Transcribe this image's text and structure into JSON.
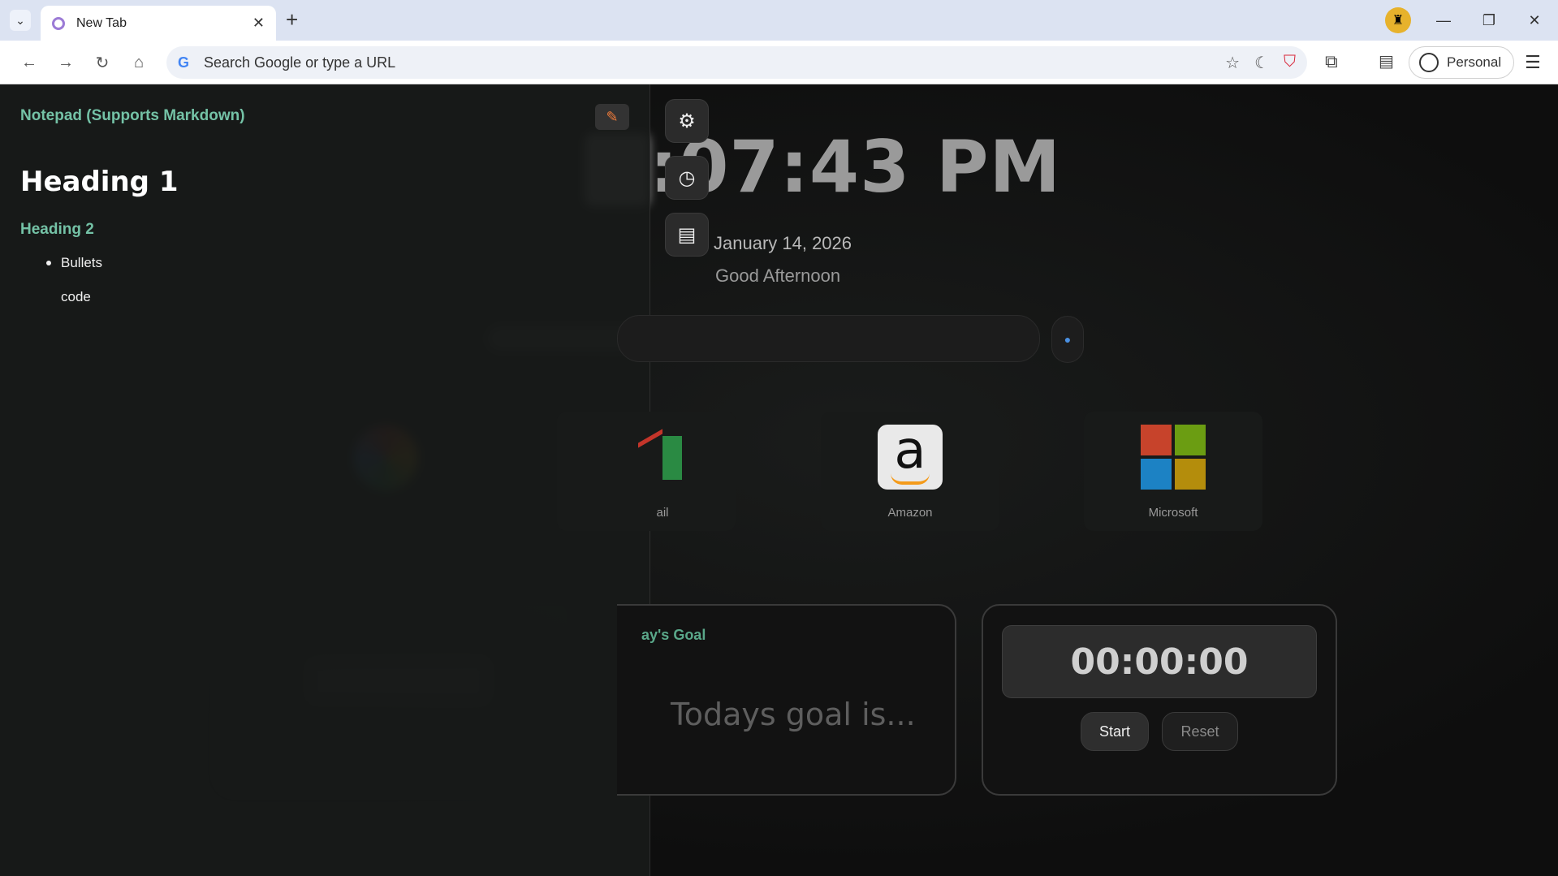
{
  "browser": {
    "tab_title": "New Tab",
    "omnibox_placeholder": "Search Google or type a URL",
    "profile_label": "Personal"
  },
  "notepad": {
    "title": "Notepad  (Supports Markdown)",
    "heading1": "Heading 1",
    "heading2": "Heading 2",
    "bullet": "Bullets",
    "code": "code"
  },
  "clock": {
    "time": ":07:43 PM",
    "date": "January 14, 2026",
    "greeting": "Good Afternoon"
  },
  "shortcuts": [
    {
      "label": "ail"
    },
    {
      "label": "Amazon"
    },
    {
      "label": "Microsoft"
    }
  ],
  "goal": {
    "title": "ay's Goal",
    "placeholder": "Todays goal is..."
  },
  "stopwatch": {
    "display": "00:00:00",
    "start_label": "Start",
    "reset_label": "Reset"
  }
}
